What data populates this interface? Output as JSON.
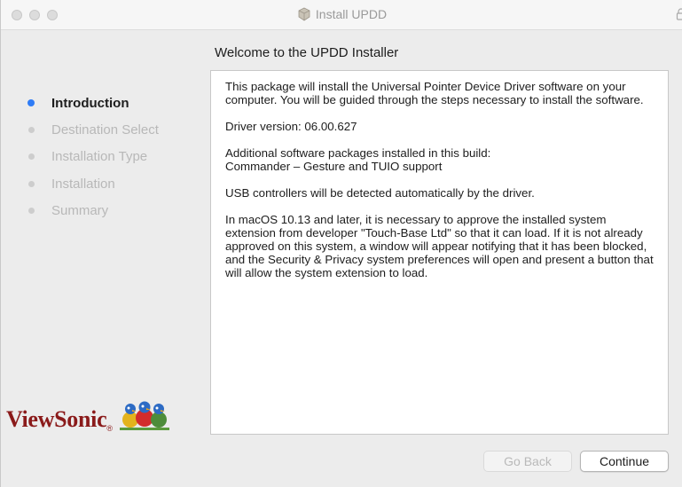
{
  "window": {
    "title": "Install UPDD"
  },
  "sidebar": {
    "steps": [
      {
        "label": "Introduction",
        "active": true
      },
      {
        "label": "Destination Select",
        "active": false
      },
      {
        "label": "Installation Type",
        "active": false
      },
      {
        "label": "Installation",
        "active": false
      },
      {
        "label": "Summary",
        "active": false
      }
    ],
    "logo_text": "ViewSonic",
    "logo_tm": "®"
  },
  "main": {
    "heading": "Welcome to the UPDD Installer",
    "paragraphs": [
      "This package will install the Universal Pointer Device Driver software on your computer.  You will be guided through the steps necessary to install the software.",
      "Driver version: 06.00.627",
      "Additional software packages installed in this build:",
      "Commander – Gesture and TUIO support",
      "USB controllers will be detected automatically by the driver.",
      "In macOS 10.13 and later, it is necessary to approve the installed system extension from developer \"Touch-Base Ltd\" so that it can load. If it is not already approved on this system, a window will appear notifying that it has been blocked, and the Security & Privacy system preferences will open and present a button that will allow the system extension to load."
    ]
  },
  "buttons": {
    "back_label": "Go Back",
    "continue_label": "Continue"
  },
  "colors": {
    "active_step": "#2f7cf6",
    "logo": "#8a1a1a"
  }
}
